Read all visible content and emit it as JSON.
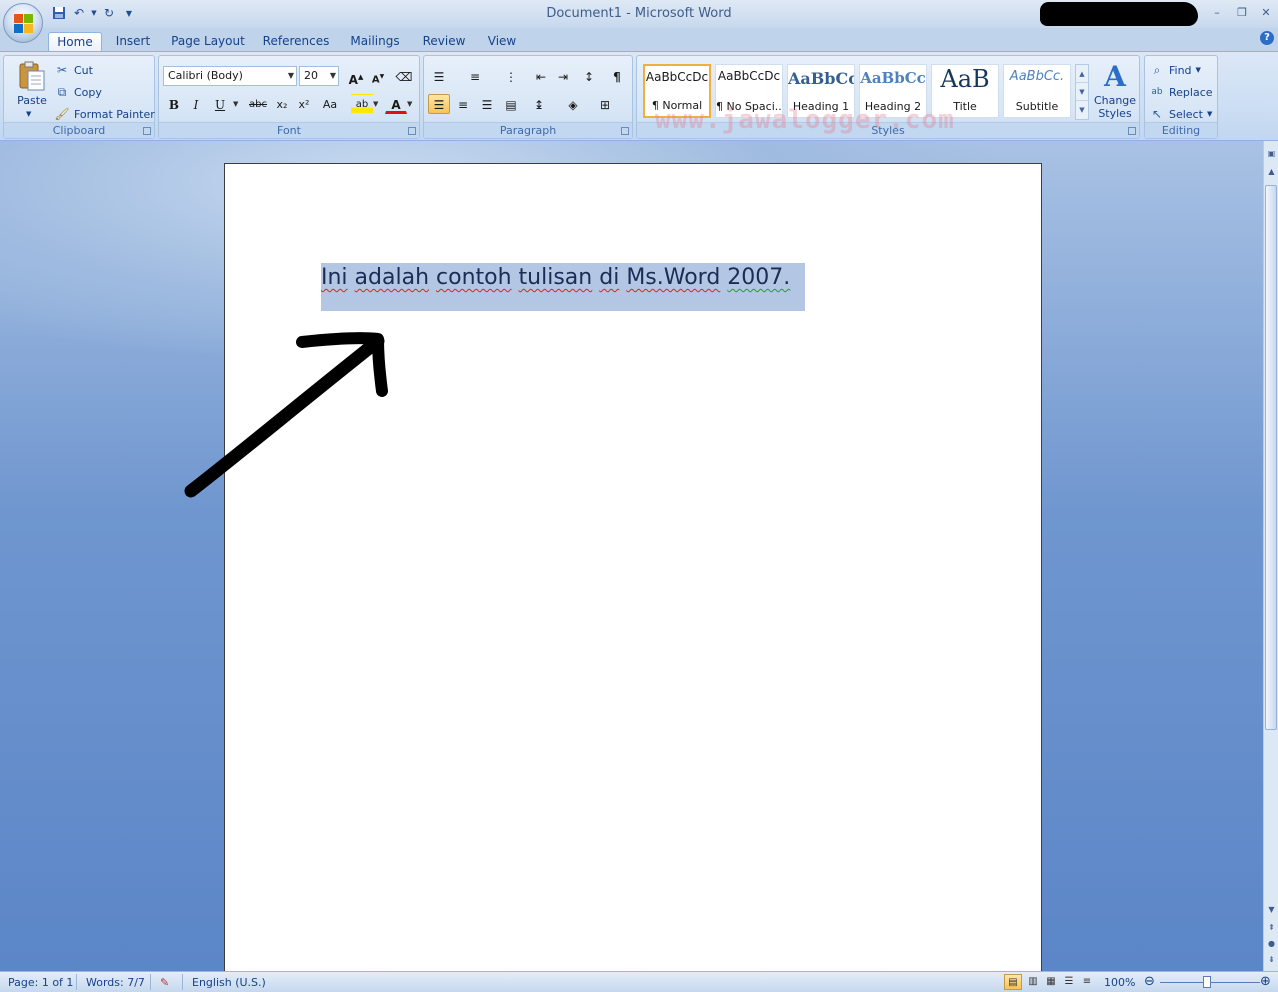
{
  "window": {
    "title": "Document1 - Microsoft Word",
    "minimize": "–",
    "restore": "❐",
    "close": "✕"
  },
  "quick_access": {
    "save_icon": "save-icon",
    "undo_icon": "undo-icon",
    "redo_icon": "redo-icon",
    "customize_icon": "dropdown-icon"
  },
  "tabs": [
    "Home",
    "Insert",
    "Page Layout",
    "References",
    "Mailings",
    "Review",
    "View"
  ],
  "active_tab": "Home",
  "ribbon": {
    "clipboard": {
      "label": "Clipboard",
      "paste": "Paste",
      "cut": "Cut",
      "copy": "Copy",
      "format_painter": "Format Painter"
    },
    "font": {
      "label": "Font",
      "font_name": "Calibri (Body)",
      "font_size": "20",
      "grow": "A",
      "shrink": "A",
      "bold": "B",
      "italic": "I",
      "underline": "U",
      "strike": "abc",
      "subscript": "x₂",
      "superscript": "x²",
      "change_case": "Aa",
      "highlight": "ab",
      "font_color": "A"
    },
    "paragraph": {
      "label": "Paragraph",
      "show_marks": "¶"
    },
    "styles": {
      "label": "Styles",
      "items": [
        {
          "sample": "AaBbCcDc",
          "name": "¶ Normal"
        },
        {
          "sample": "AaBbCcDc",
          "name": "¶ No Spaci..."
        },
        {
          "sample": "AaBbCc",
          "name": "Heading 1"
        },
        {
          "sample": "AaBbCc",
          "name": "Heading 2"
        },
        {
          "sample": "AaB",
          "name": "Title"
        },
        {
          "sample": "AaBbCc.",
          "name": "Subtitle"
        }
      ],
      "change_styles": "Change Styles"
    },
    "editing": {
      "label": "Editing",
      "find": "Find",
      "replace": "Replace",
      "select": "Select"
    }
  },
  "watermark": "www.jawalogger.com",
  "document": {
    "words": [
      "Ini",
      "adalah",
      "contoh",
      "tulisan",
      "di",
      "Ms.Word",
      "2007."
    ]
  },
  "status": {
    "page": "Page: 1 of 1",
    "words": "Words: 7/7",
    "language": "English (U.S.)",
    "zoom": "100%",
    "zoom_level": 1.0
  },
  "colors": {
    "selection": "#b3c6e3",
    "ribbon": "#cddff4",
    "background": "#5b86c7",
    "arrow": "#000000"
  }
}
